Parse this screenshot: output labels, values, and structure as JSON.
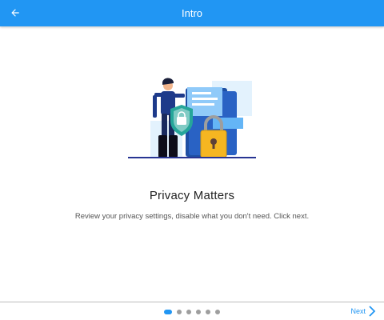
{
  "appbar": {
    "title": "Intro",
    "back_icon": "arrow-left-icon",
    "background": "#2196f3"
  },
  "slide": {
    "illustration": "security-guard-shield-padlock-illustration",
    "title": "Privacy Matters",
    "subtitle": "Review your privacy settings, disable what you don't need. Click next."
  },
  "pager": {
    "total_pages": 6,
    "current_page": 1,
    "next_label": "Next",
    "next_icon": "chevron-right-icon",
    "active_color": "#2196f3",
    "inactive_color": "#9e9e9e"
  }
}
